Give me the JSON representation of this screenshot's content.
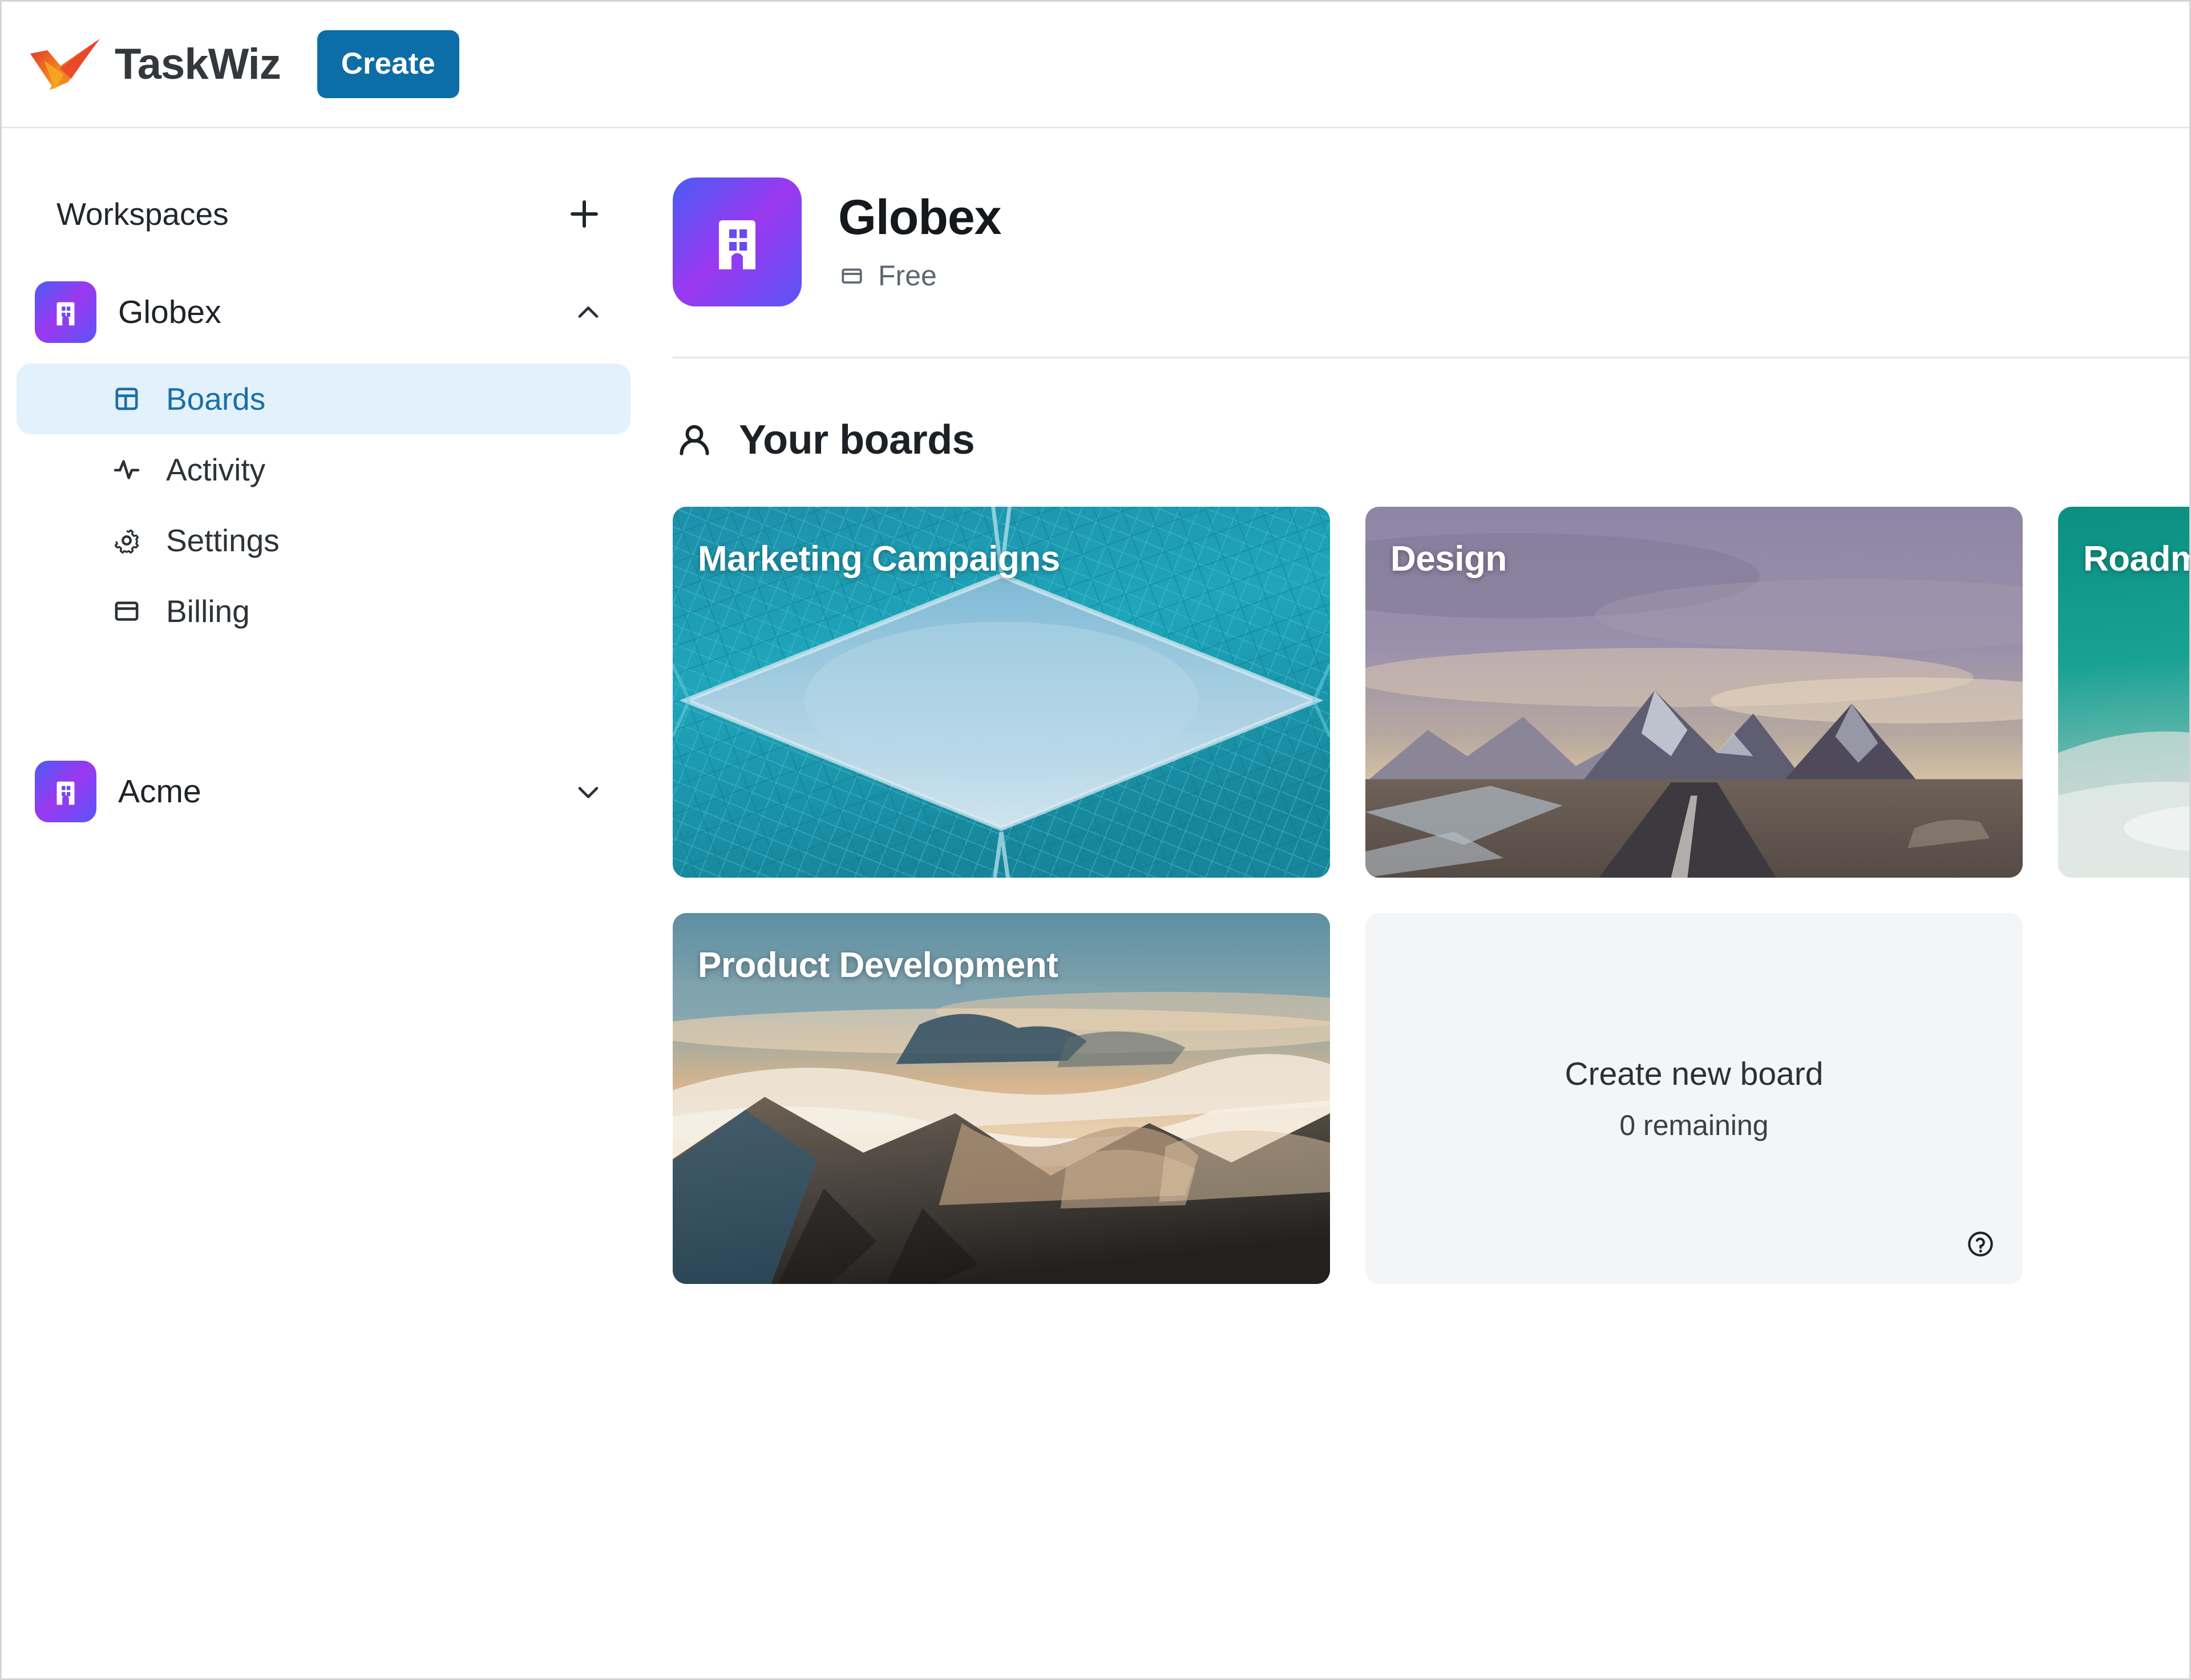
{
  "topbar": {
    "logo_icon": "checkmark-logo",
    "brand": "TaskWiz",
    "create_label": "Create",
    "create_color": "#0d6da6"
  },
  "sidebar": {
    "section_label": "Workspaces",
    "add_workspace_icon": "plus-icon",
    "workspaces": [
      {
        "name": "Globex",
        "icon": "building-icon",
        "expanded": true,
        "chevron_icon": "chevron-up-icon",
        "items": [
          {
            "label": "Boards",
            "icon": "board-layout-icon",
            "active": true
          },
          {
            "label": "Activity",
            "icon": "activity-pulse-icon",
            "active": false
          },
          {
            "label": "Settings",
            "icon": "gear-icon",
            "active": false
          },
          {
            "label": "Billing",
            "icon": "credit-card-icon",
            "active": false
          }
        ]
      },
      {
        "name": "Acme",
        "icon": "building-icon",
        "expanded": false,
        "chevron_icon": "chevron-down-icon",
        "items": []
      }
    ],
    "active_accent": "#1a6fa8",
    "active_bg": "#e2f1fb",
    "tile_gradient_from": "#4a5cf5",
    "tile_gradient_to": "#9b38f0"
  },
  "workspace_header": {
    "icon": "building-icon",
    "title": "Globex",
    "plan_icon": "credit-card-icon",
    "plan_label": "Free"
  },
  "boards_section": {
    "icon": "person-icon",
    "heading": "Your boards",
    "boards": [
      {
        "title": "Marketing Campaigns",
        "art": "teal-geometric-architecture"
      },
      {
        "title": "Design",
        "art": "purple-mountain-road"
      },
      {
        "title": "Roadmap",
        "art": "teal-ocean-wave"
      },
      {
        "title": "Product Development",
        "art": "aerial-mountain-clouds"
      }
    ],
    "create_board": {
      "title": "Create new board",
      "remaining": "0 remaining",
      "help_icon": "help-circle-icon"
    }
  }
}
